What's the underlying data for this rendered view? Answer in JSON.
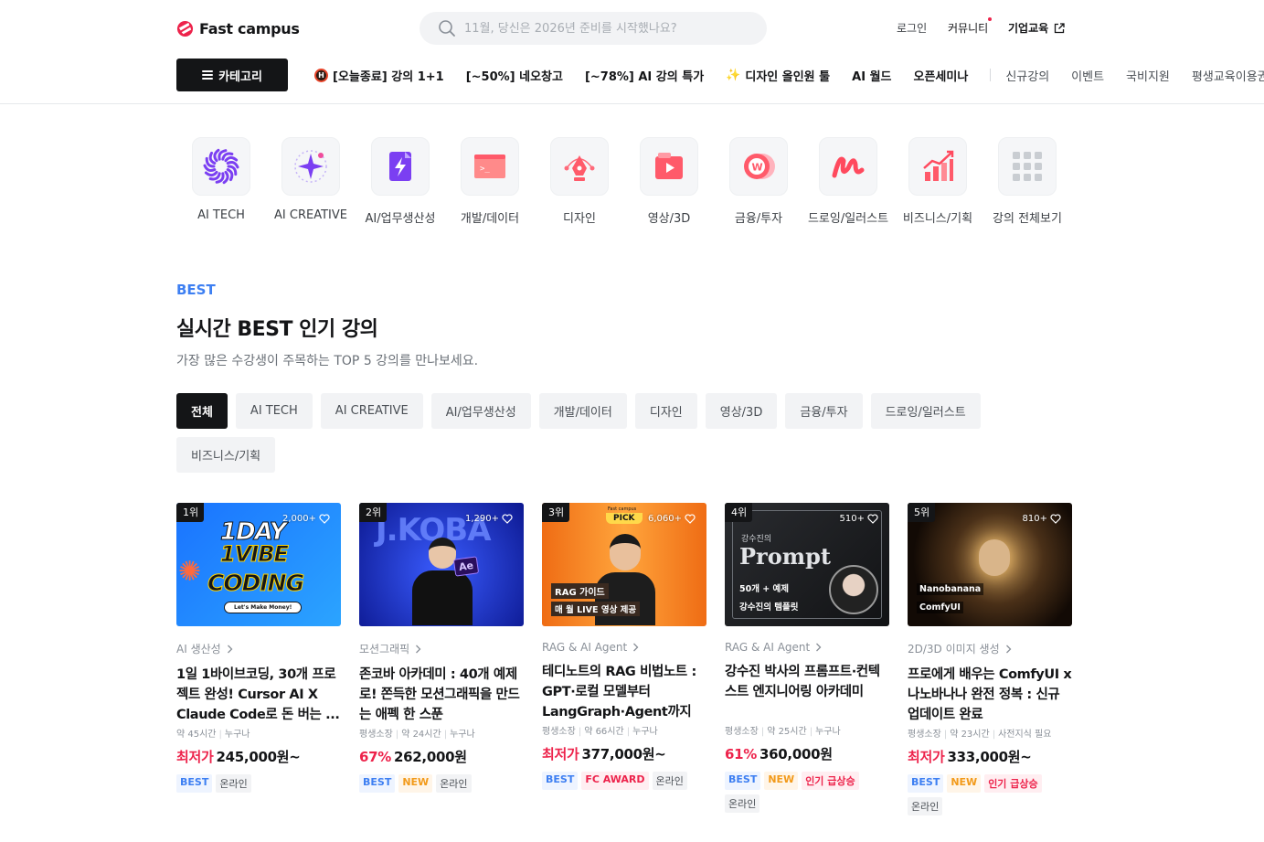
{
  "header": {
    "logo_text": "Fast campus",
    "search_placeholder": "11월, 당신은 2026년 준비를 시작했나요?",
    "login": "로그인",
    "community": "커뮤니티",
    "corporate": "기업교육",
    "category_button": "카테고리"
  },
  "nav": [
    {
      "label": "[오늘종료] 강의 1+1",
      "style": "bold",
      "icon": "h-badge-icon"
    },
    {
      "label": "[~50%] 네오창고",
      "style": "bold"
    },
    {
      "label": "[~78%] AI 강의 특가",
      "style": "bold"
    },
    {
      "label": "디자인 올인원 툴",
      "style": "bold",
      "icon": "sparkle-icon"
    },
    {
      "label": "AI 월드",
      "style": "bold"
    },
    {
      "label": "오픈세미나",
      "style": "bold"
    },
    {
      "label": "신규강의",
      "style": "light"
    },
    {
      "label": "이벤트",
      "style": "light"
    },
    {
      "label": "국비지원",
      "style": "light"
    },
    {
      "label": "평생교육이용권",
      "style": "light"
    }
  ],
  "categories": [
    {
      "label": "AI TECH",
      "icon": "ai-tech-icon"
    },
    {
      "label": "AI CREATIVE",
      "icon": "ai-creative-icon"
    },
    {
      "label": "AI/업무생산성",
      "icon": "ai-productivity-icon"
    },
    {
      "label": "개발/데이터",
      "icon": "dev-data-icon"
    },
    {
      "label": "디자인",
      "icon": "design-icon"
    },
    {
      "label": "영상/3D",
      "icon": "video-3d-icon"
    },
    {
      "label": "금융/투자",
      "icon": "finance-icon"
    },
    {
      "label": "드로잉/일러스트",
      "icon": "drawing-icon"
    },
    {
      "label": "비즈니스/기획",
      "icon": "business-icon"
    },
    {
      "label": "강의 전체보기",
      "icon": "grid-icon"
    }
  ],
  "section": {
    "eyebrow": "BEST",
    "title": "실시간 BEST 인기 강의",
    "subtitle": "가장 많은 수강생이 주목하는 TOP 5 강의를 만나보세요."
  },
  "filters": [
    "전체",
    "AI TECH",
    "AI CREATIVE",
    "AI/업무생산성",
    "개발/데이터",
    "디자인",
    "영상/3D",
    "금융/투자",
    "드로잉/일러스트",
    "비즈니스/기획"
  ],
  "active_filter": 0,
  "cards": [
    {
      "rank": "1위",
      "likes": "2,000+",
      "category": "AI 생산성",
      "title": "1일 1바이브코딩, 30개 프로젝트 완성! Cursor AI X Claude Code로 돈 버는 ...",
      "meta": [
        "약 45시간",
        "누구나"
      ],
      "price_prefix": "최저가",
      "price": "245,000원~",
      "tags": [
        {
          "label": "BEST",
          "kind": "best"
        },
        {
          "label": "온라인",
          "kind": "online"
        }
      ],
      "thumb_text": [
        "1DAY",
        "1VIBE",
        "CODING",
        "Let's Make Money!"
      ],
      "bg": "#1f8bff"
    },
    {
      "rank": "2위",
      "likes": "1,290+",
      "category": "모션그래픽",
      "title": "존코바 아카데미 : 40개 예제로! 쫀득한 모션그래픽을 만드는 애펙 한 스푼",
      "meta": [
        "평생소장",
        "약 24시간",
        "누구나"
      ],
      "price_prefix": "67%",
      "price": "262,000원",
      "tags": [
        {
          "label": "BEST",
          "kind": "best"
        },
        {
          "label": "NEW",
          "kind": "new"
        },
        {
          "label": "온라인",
          "kind": "online"
        }
      ],
      "thumb_text": [
        "J.KOBA",
        "Ae"
      ],
      "bg": "#1a2fd6"
    },
    {
      "rank": "3위",
      "likes": "6,060+",
      "category": "RAG & AI Agent",
      "title": "테디노트의 RAG 비법노트 : GPT·로컬 모델부터 LangGraph·Agent까지",
      "meta": [
        "평생소장",
        "약 66시간",
        "누구나"
      ],
      "price_prefix": "최저가",
      "price": "377,000원~",
      "tags": [
        {
          "label": "BEST",
          "kind": "best"
        },
        {
          "label": "FC AWARD",
          "kind": "award"
        },
        {
          "label": "온라인",
          "kind": "online"
        }
      ],
      "thumb_text": [
        "Fast campus",
        "PICK",
        "RAG 가이드",
        "매 월 LIVE 영상 제공"
      ],
      "bg": "#f07a18"
    },
    {
      "rank": "4위",
      "likes": "510+",
      "category": "RAG & AI Agent",
      "title": "강수진 박사의 프롬프트·컨텍스트 엔지니어링 아카데미",
      "meta": [
        "평생소장",
        "약 25시간",
        "누구나"
      ],
      "price_prefix": "61%",
      "price": "360,000원",
      "tags": [
        {
          "label": "BEST",
          "kind": "best"
        },
        {
          "label": "NEW",
          "kind": "new"
        },
        {
          "label": "인기 급상승",
          "kind": "hot"
        },
        {
          "label": "온라인",
          "kind": "online"
        }
      ],
      "thumb_text": [
        "강수진의",
        "Prompt",
        "50개 + 예제",
        "강수진의 템플릿"
      ],
      "bg": "#1d1f22"
    },
    {
      "rank": "5위",
      "likes": "810+",
      "category": "2D/3D 이미지 생성",
      "title": "프로에게 배우는 ComfyUI x 나노바나나 완전 정복 : 신규 업데이트 완료",
      "meta": [
        "평생소장",
        "약 23시간",
        "사전지식 필요"
      ],
      "price_prefix": "최저가",
      "price": "333,000원~",
      "tags": [
        {
          "label": "BEST",
          "kind": "best"
        },
        {
          "label": "NEW",
          "kind": "new"
        },
        {
          "label": "인기 급상승",
          "kind": "hot"
        },
        {
          "label": "온라인",
          "kind": "online"
        }
      ],
      "thumb_text": [
        "Nanobanana",
        "ComfyUI"
      ],
      "bg": "#2a1d12"
    }
  ],
  "colors": {
    "brand_red": "#ed234b",
    "accent_blue": "#3d7ff2",
    "dark": "#141517"
  }
}
